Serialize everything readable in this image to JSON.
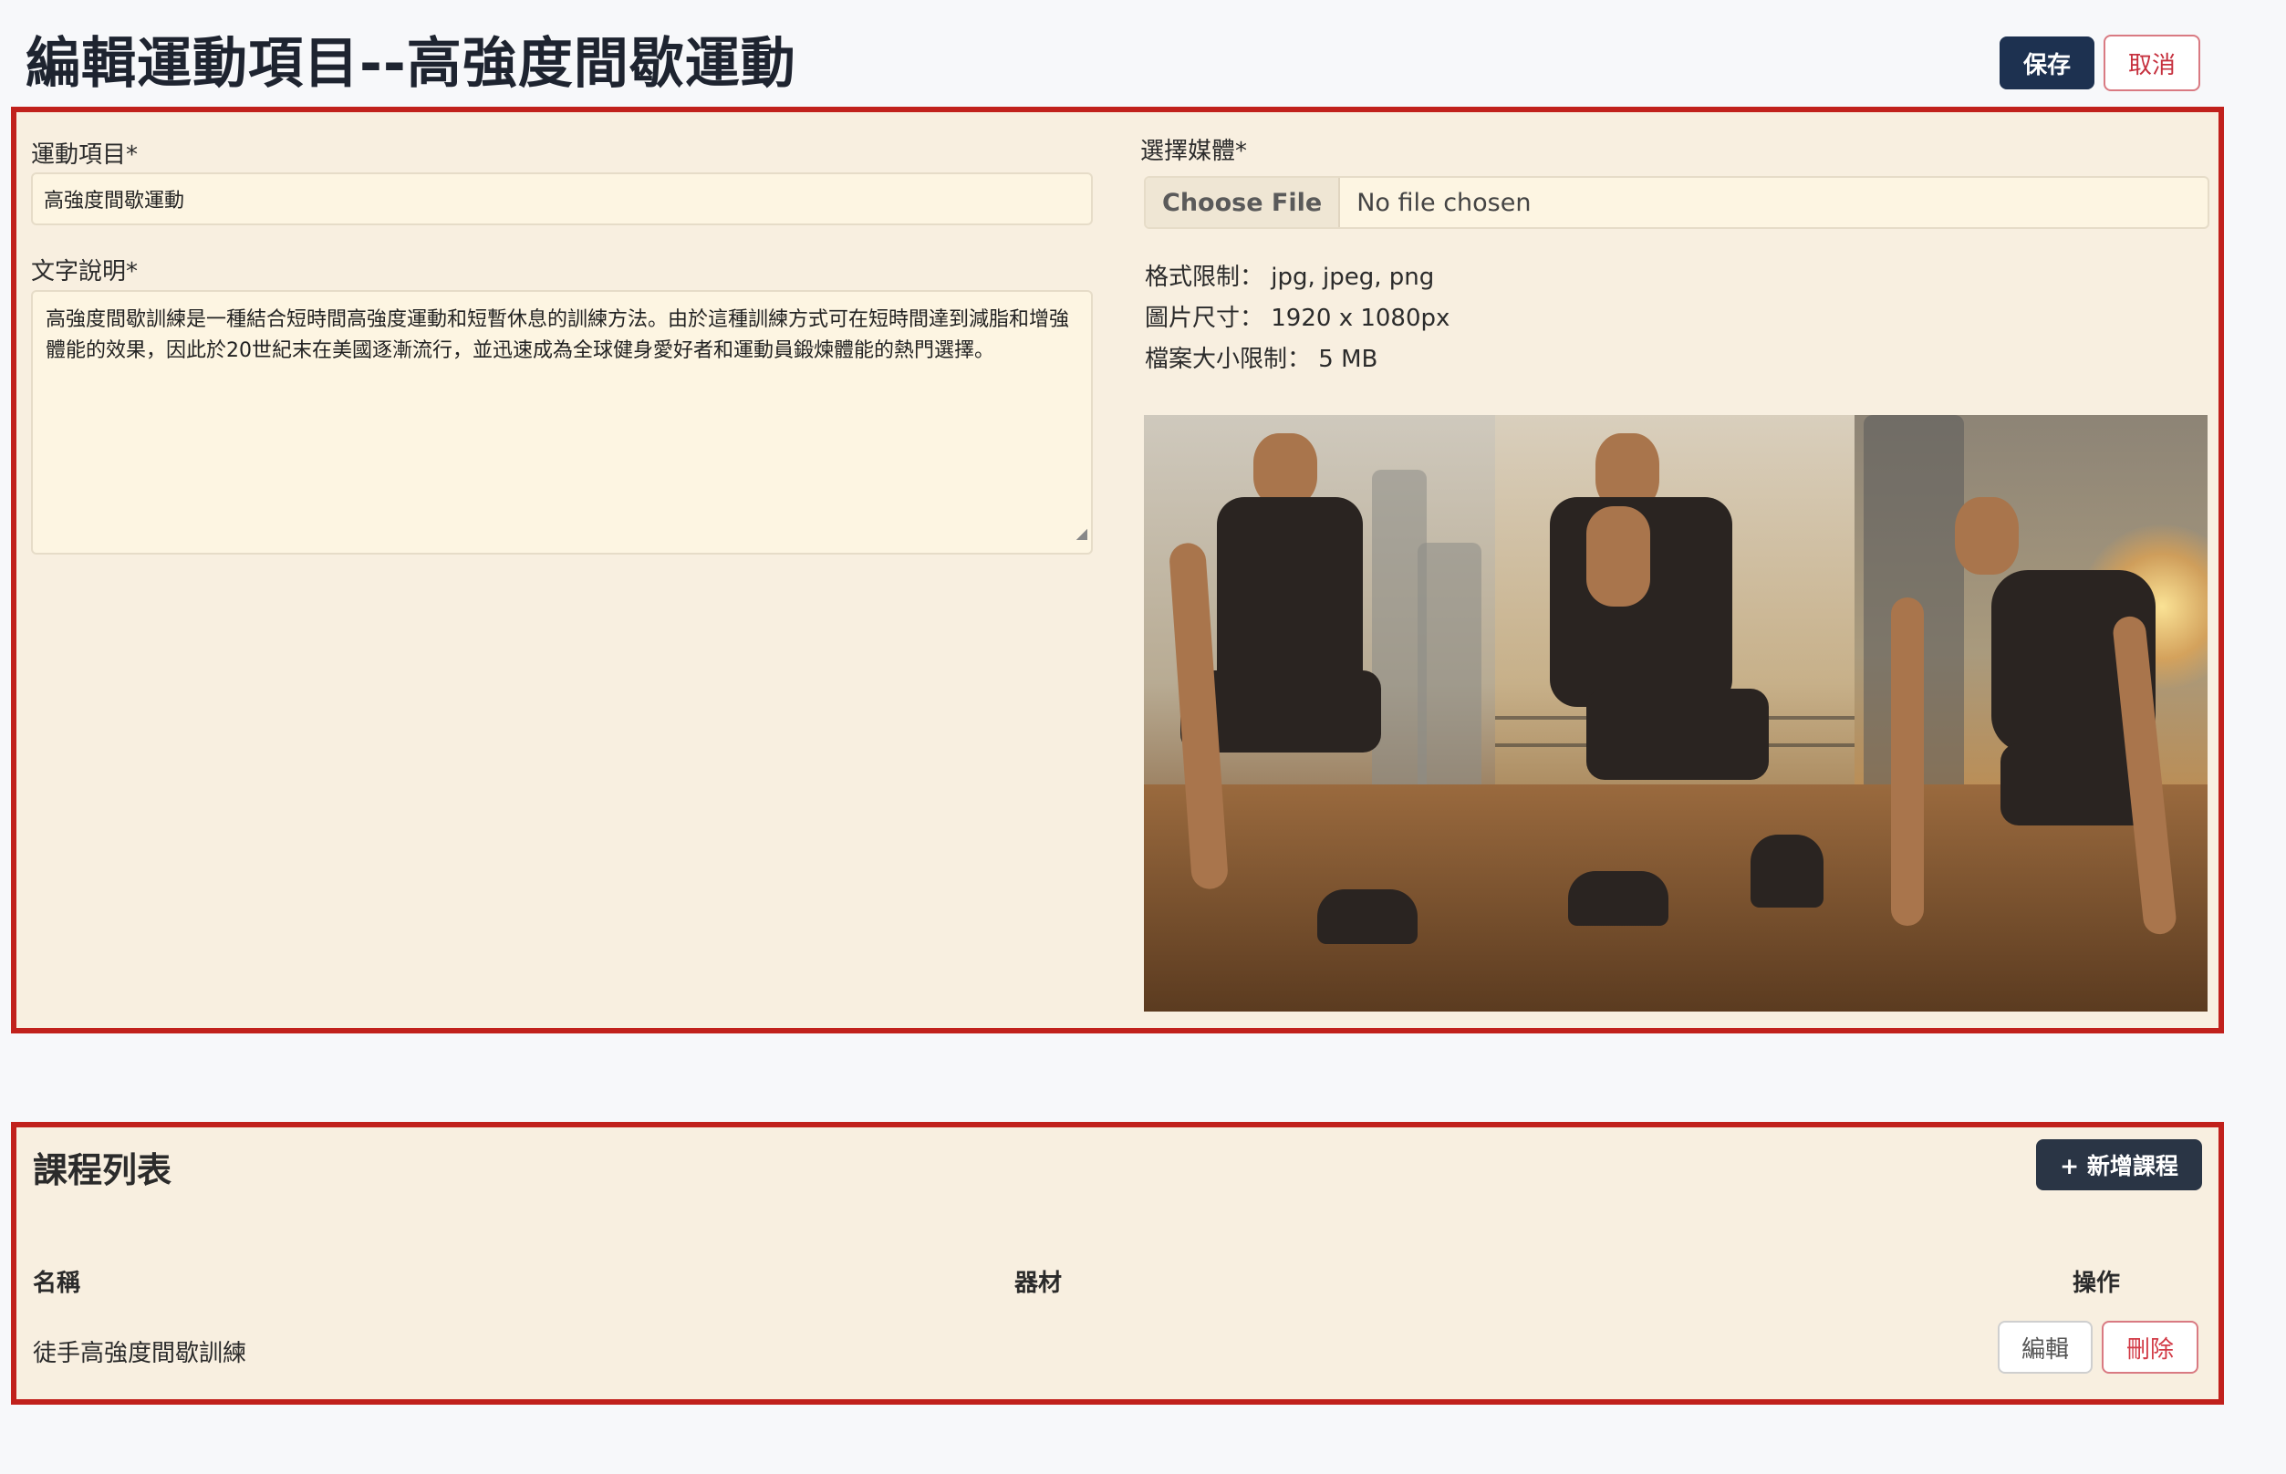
{
  "header": {
    "title": "編輯運動項目--高強度間歇運動",
    "save_label": "保存",
    "cancel_label": "取消"
  },
  "form": {
    "name_label": "運動項目*",
    "name_value": "高強度間歇運動",
    "desc_label": "文字說明*",
    "desc_value": "高強度間歇訓練是一種結合短時間高強度運動和短暫休息的訓練方法。由於這種訓練方式可在短時間達到減脂和增強體能的效果，因此於20世紀末在美國逐漸流行，並迅速成為全球健身愛好者和運動員鍛煉體能的熱門選擇。",
    "media_label": "選擇媒體*",
    "choose_file_label": "Choose File",
    "file_status": "No file chosen",
    "format_limit": "格式限制： jpg, jpeg, png",
    "image_size": "圖片尺寸： 1920 x 1080px",
    "file_size_limit": "檔案大小限制： 5 MB"
  },
  "courses": {
    "title": "課程列表",
    "add_label": "+ 新增課程",
    "columns": [
      "名稱",
      "器材",
      "操作"
    ],
    "rows": [
      {
        "name": "徒手高強度間歇訓練",
        "equipment": "",
        "edit_label": "編輯",
        "delete_label": "刪除"
      }
    ]
  },
  "colors": {
    "primary": "#1d3150",
    "danger": "#c6303e",
    "panel_bg": "#f8efe0",
    "highlight_border": "#c1211c"
  }
}
